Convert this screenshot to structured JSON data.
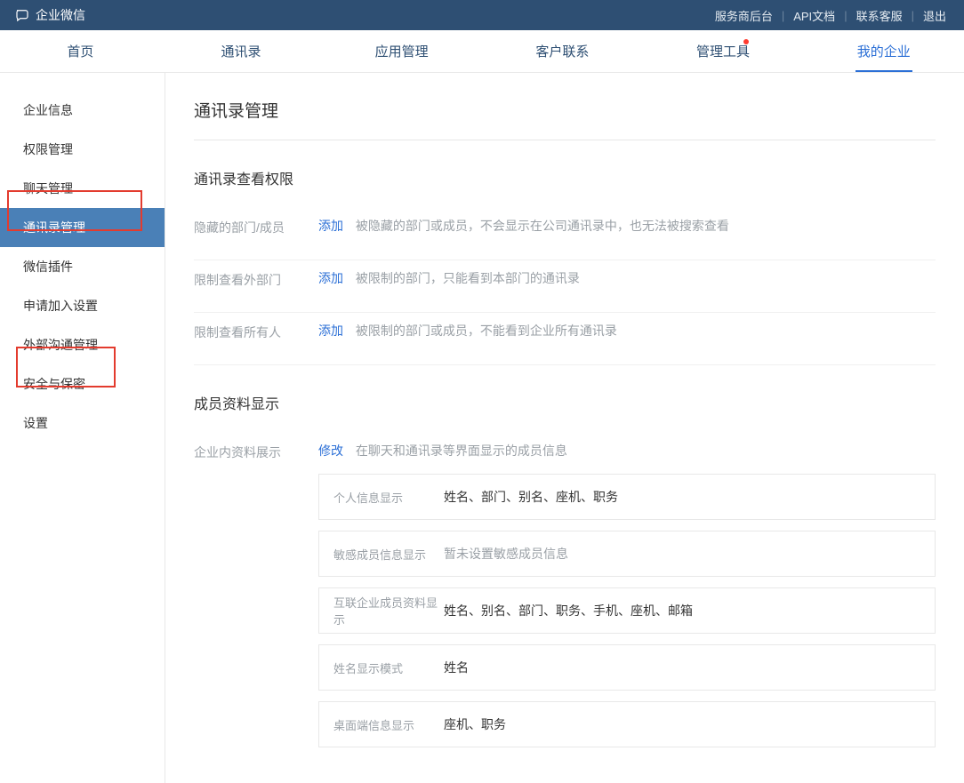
{
  "topbar": {
    "brand": "企业微信",
    "links": {
      "backend": "服务商后台",
      "api": "API文档",
      "support": "联系客服",
      "logout": "退出"
    }
  },
  "tabs": {
    "home": "首页",
    "contacts": "通讯录",
    "apps": "应用管理",
    "customer": "客户联系",
    "tools": "管理工具",
    "company": "我的企业"
  },
  "sidebar": {
    "items": [
      {
        "label": "企业信息"
      },
      {
        "label": "权限管理"
      },
      {
        "label": "聊天管理"
      },
      {
        "label": "通讯录管理"
      },
      {
        "label": "微信插件"
      },
      {
        "label": "申请加入设置"
      },
      {
        "label": "外部沟通管理"
      },
      {
        "label": "安全与保密"
      },
      {
        "label": "设置"
      }
    ]
  },
  "page": {
    "title": "通讯录管理",
    "section1_title": "通讯录查看权限",
    "rows": {
      "hidden": {
        "label": "隐藏的部门/成员",
        "action": "添加",
        "hint": "被隐藏的部门或成员，不会显示在公司通讯录中，也无法被搜索查看"
      },
      "restrict_ext": {
        "label": "限制查看外部门",
        "action": "添加",
        "hint": "被限制的部门，只能看到本部门的通讯录"
      },
      "restrict_all": {
        "label": "限制查看所有人",
        "action": "添加",
        "hint": "被限制的部门或成员，不能看到企业所有通讯录"
      }
    },
    "section2_title": "成员资料显示",
    "profile": {
      "label": "企业内资料展示",
      "action": "修改",
      "hint": "在聊天和通讯录等界面显示的成员信息"
    },
    "cards": [
      {
        "label": "个人信息显示",
        "value": "姓名、部门、别名、座机、职务"
      },
      {
        "label": "敏感成员信息显示",
        "value": "暂未设置敏感成员信息"
      },
      {
        "label": "互联企业成员资料显示",
        "value": "姓名、别名、部门、职务、手机、座机、邮箱"
      },
      {
        "label": "姓名显示模式",
        "value": "姓名"
      },
      {
        "label": "桌面端信息显示",
        "value": "座机、职务"
      }
    ]
  }
}
